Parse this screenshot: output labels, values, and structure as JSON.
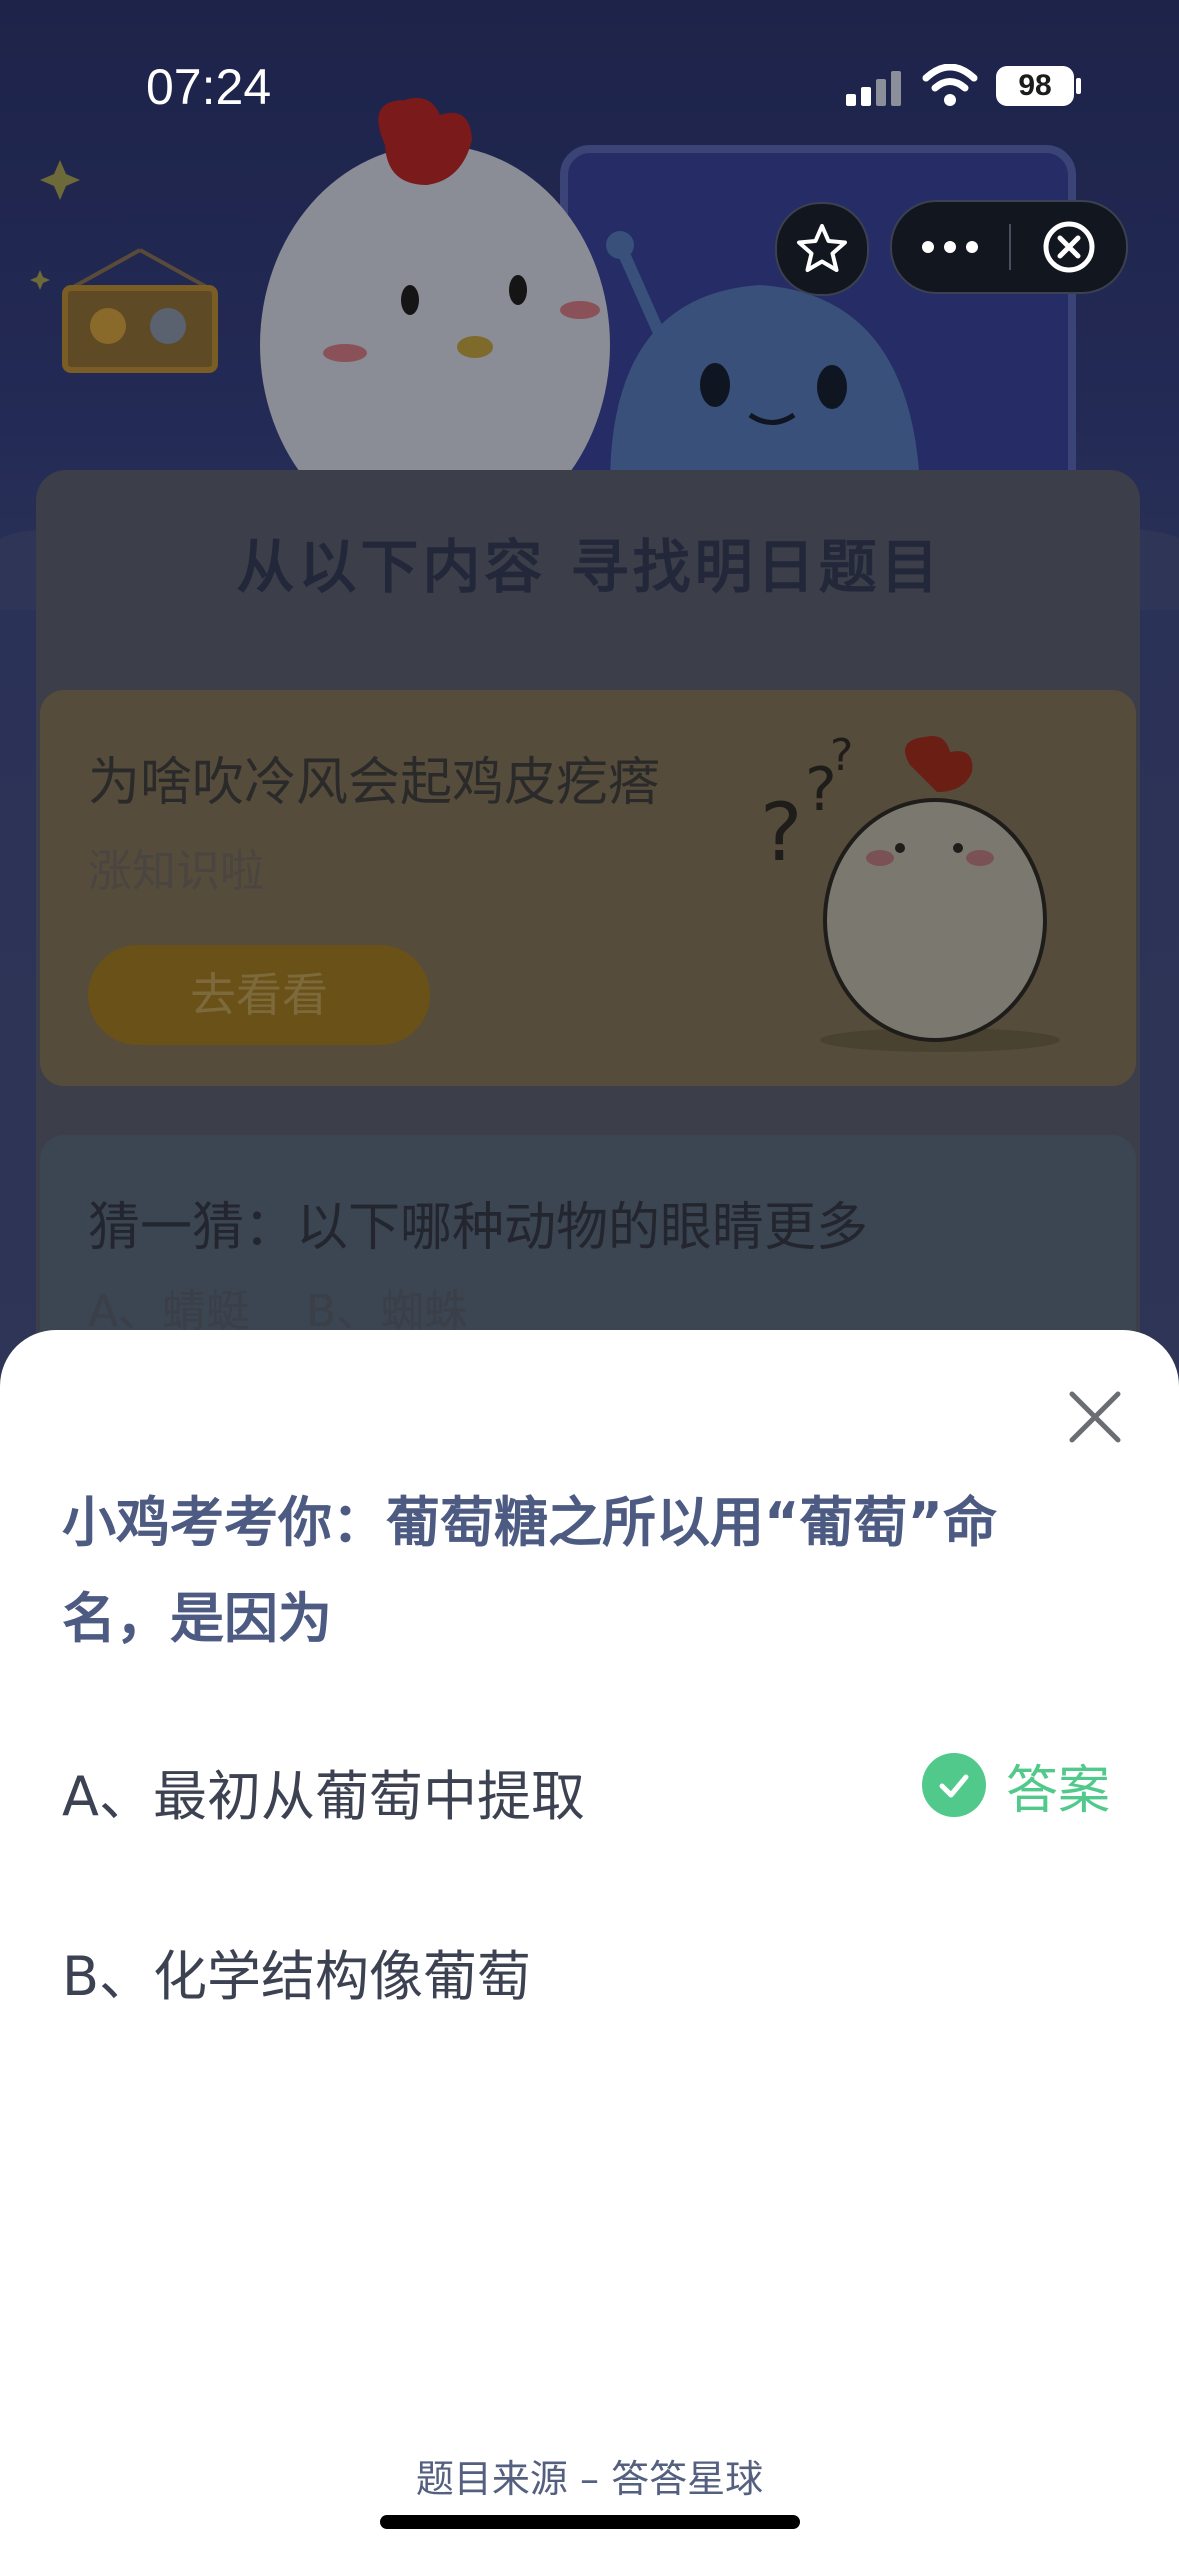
{
  "status_bar": {
    "time": "07:24",
    "battery": "98"
  },
  "background": {
    "heading": "从以下内容 寻找明日题目",
    "article": {
      "title": "为啥吹冷风会起鸡皮疙瘩",
      "subtitle": "涨知识啦",
      "button": "去看看"
    },
    "guess": {
      "title": "猜一猜：以下哪种动物的眼睛更多",
      "options": "A、蜻蜓    B、蜘蛛"
    }
  },
  "sheet": {
    "question": "小鸡考考你：葡萄糖之所以用“葡萄”命名，是因为",
    "options": [
      {
        "label": "A、最初从葡萄中提取",
        "correct": true
      },
      {
        "label": "B、化学结构像葡萄",
        "correct": false
      }
    ],
    "answer_label": "答案",
    "source": "题目来源 – 答答星球"
  },
  "colors": {
    "question": "#4d5b82",
    "answer": "#51c98b",
    "option_text": "#3c4252"
  }
}
